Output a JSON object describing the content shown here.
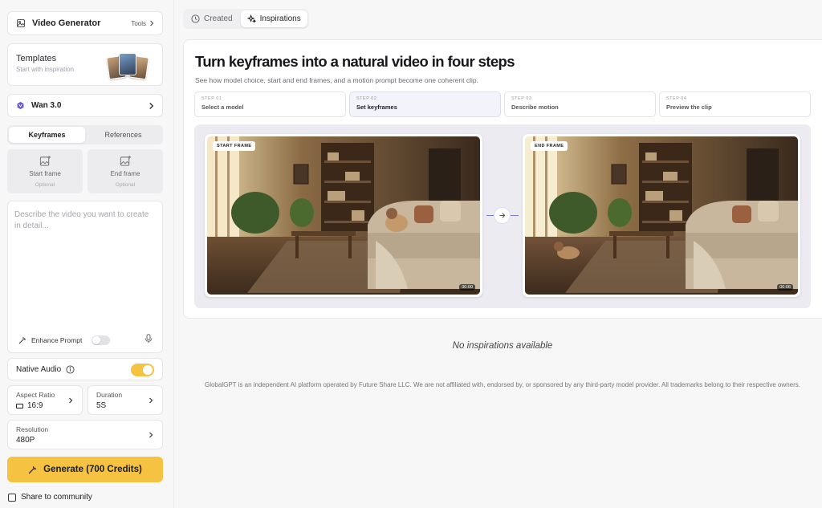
{
  "sidebar": {
    "app": {
      "title": "Video Generator",
      "tools_label": "Tools",
      "icon": "film-icon"
    },
    "templates": {
      "title": "Templates",
      "subtitle": "Start with inspiration"
    },
    "model": {
      "name": "Wan 3.0",
      "icon": "wan-logo-icon"
    },
    "mode_tabs": [
      {
        "label": "Keyframes",
        "active": true
      },
      {
        "label": "References",
        "active": false
      }
    ],
    "start_frame": {
      "label": "Start frame",
      "hint": "Optional"
    },
    "end_frame": {
      "label": "End frame",
      "hint": "Optional"
    },
    "prompt": {
      "placeholder": "Describe the video you want to create in detail...",
      "value": ""
    },
    "enhance_prompt": {
      "label": "Enhance Prompt",
      "enabled": false
    },
    "native_audio": {
      "label": "Native Audio",
      "enabled": true
    },
    "aspect_ratio": {
      "label": "Aspect Ratio",
      "value": "16:9"
    },
    "duration": {
      "label": "Duration",
      "value": "5S"
    },
    "resolution": {
      "label": "Resolution",
      "value": "480P"
    },
    "generate_label": "Generate (700 Credits)",
    "share": {
      "label": "Share to community",
      "checked": false
    }
  },
  "tabs": [
    {
      "label": "Created",
      "icon": "clock-icon",
      "active": false
    },
    {
      "label": "Inspirations",
      "icon": "sparkle-icon",
      "active": true
    }
  ],
  "hero": {
    "title": "Turn keyframes into a natural video in four steps",
    "subtitle": "See how model choice, start and end frames, and a motion prompt become one coherent clip.",
    "steps": [
      {
        "num": "STEP 01",
        "title": "Select a model",
        "active": false
      },
      {
        "num": "STEP 02",
        "title": "Set keyframes",
        "active": true
      },
      {
        "num": "STEP 03",
        "title": "Describe motion",
        "active": false
      },
      {
        "num": "STEP 04",
        "title": "Preview the clip",
        "active": false
      }
    ],
    "start_frame": {
      "badge": "START FRAME",
      "time": "00:00"
    },
    "end_frame": {
      "badge": "END FRAME",
      "time": "00:06"
    }
  },
  "empty_state": "No inspirations available",
  "footer": "GlobalGPT is an independent AI platform operated by Future Share LLC. We are not affiliated with, endorsed by, or sponsored by any third-party model provider. All trademarks belong to their respective owners.",
  "colors": {
    "accent_yellow": "#f5c242",
    "accent_indigo": "#7b7bd6",
    "page_bg": "#f7f7f8"
  }
}
